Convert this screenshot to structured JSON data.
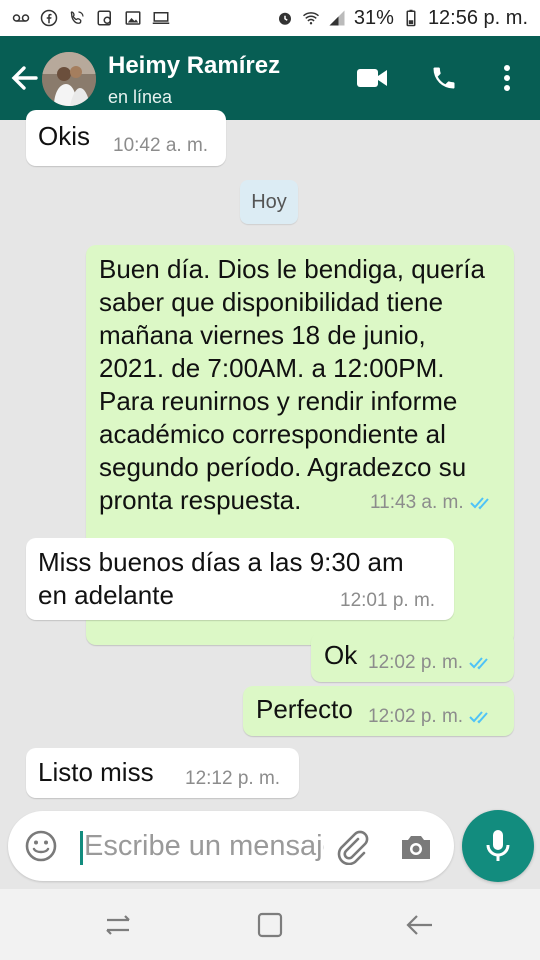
{
  "status_bar": {
    "left_icons": [
      "voicemail-icon",
      "facebook-icon",
      "viber-icon",
      "messenger-icon",
      "gallery-icon",
      "screen-icon"
    ],
    "alarm_icon": "alarm-icon",
    "wifi_icon": "wifi-icon",
    "signal_icon": "signal-icon",
    "battery_percent": "31%",
    "battery_icon": "battery-icon",
    "time": "12:56 p. m."
  },
  "header": {
    "contact_name": "Heimy Ramírez",
    "status": "en línea",
    "icons": {
      "back": "back-arrow-icon",
      "video": "video-call-icon",
      "call": "phone-icon",
      "more": "more-vert-icon"
    }
  },
  "chat": {
    "date_divider": "Hoy",
    "messages": [
      {
        "direction": "in",
        "text": "Okis",
        "time": "10:42 a. m."
      },
      {
        "direction": "out",
        "text": "Buen día. Dios le bendiga, quería\nsaber que disponibilidad tiene\nmañana viernes 18 de junio,\n2021. de 7:00AM. a 12:00PM.\nPara reunirnos y rendir informe\nacadémico correspondiente al\nsegundo período. Agradezco su\npronta respuesta.",
        "time": "11:43 a. m.",
        "status": "read"
      },
      {
        "direction": "in",
        "text": "Miss buenos días a las 9:30 am\nen adelante",
        "time": "12:01 p. m."
      },
      {
        "direction": "out",
        "text": "Ok",
        "time": "12:02 p. m.",
        "status": "read"
      },
      {
        "direction": "out",
        "text": "Perfecto",
        "time": "12:02 p. m.",
        "status": "read"
      },
      {
        "direction": "in",
        "text": "Listo miss",
        "time": "12:12 p. m."
      }
    ],
    "read_tick_color": "#4fc3f7"
  },
  "composer": {
    "placeholder": "Escribe un mensaje",
    "icons": {
      "emoji": "emoji-icon",
      "attach": "attach-icon",
      "camera": "camera-icon",
      "mic": "mic-icon"
    }
  },
  "nav_bar": {
    "icons": [
      "recents-icon",
      "home-icon",
      "back-icon"
    ]
  },
  "colors": {
    "header": "#075e54",
    "accent": "#128c7e",
    "outgoing_bubble": "#dcf8c6",
    "incoming_bubble": "#ffffff",
    "chat_background": "#e6e6e6"
  }
}
